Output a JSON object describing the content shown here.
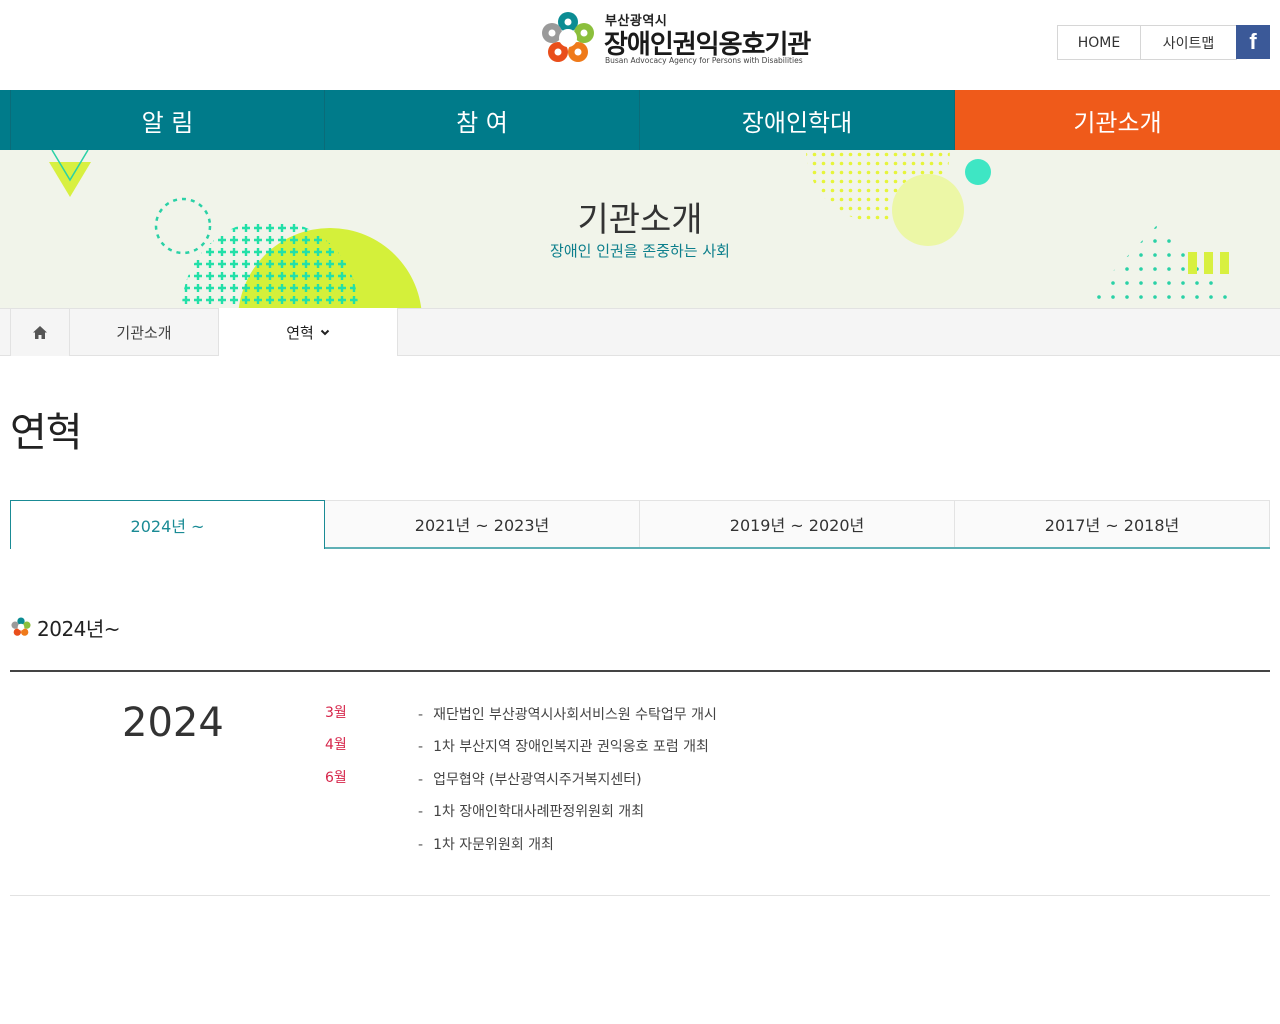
{
  "header": {
    "logo_top": "부산광역시",
    "logo_main": "장애인권익옹호기관",
    "logo_sub": "Busan Advocacy Agency for Persons with Disabilities",
    "util_home": "HOME",
    "util_sitemap": "사이트맵",
    "util_facebook": "f"
  },
  "gnb": {
    "items": [
      "알 림",
      "참 여",
      "장애인학대",
      "기관소개"
    ],
    "active_index": 3
  },
  "visual": {
    "title": "기관소개",
    "subtitle": "장애인 인권을 존중하는 사회"
  },
  "location": {
    "level1": "기관소개",
    "level2": "연혁"
  },
  "page": {
    "title": "연혁"
  },
  "tabs": [
    "2024년 ~",
    "2021년 ~ 2023년",
    "2019년 ~ 2020년",
    "2017년 ~ 2018년"
  ],
  "section": {
    "heading": "2024년~"
  },
  "timeline": {
    "year": "2024",
    "months": [
      "3월",
      "4월",
      "6월"
    ],
    "events": [
      "재단법인 부산광역시사회서비스원 수탁업무 개시",
      "1차 부산지역 장애인복지관 권익옹호 포럼 개최",
      "업무협약 (부산광역시주거복지센터)",
      "1차 장애인학대사례판정위원회 개최",
      "1차 자문위원회 개최"
    ]
  },
  "colors": {
    "teal": "#007b8a",
    "orange": "#ef5a1a",
    "red_month": "#d6254a",
    "lime": "#d4f03a",
    "mint": "#3ee6c4"
  }
}
